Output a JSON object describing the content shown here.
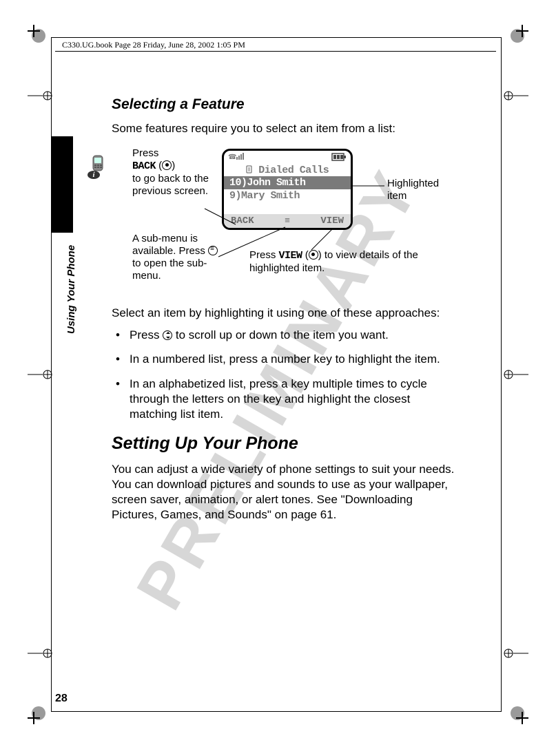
{
  "running_header": "C330.UG.book  Page 28  Friday, June 28, 2002  1:05 PM",
  "side_label": "Using Your Phone",
  "page_number": "28",
  "watermark": "PRELIMINARY",
  "subhead": "Selecting a Feature",
  "intro": "Some features require you to select an item from a list:",
  "figure": {
    "callout_back_1": "Press",
    "callout_back_key": "BACK",
    "callout_back_2": "to go back to the previous screen.",
    "callout_submenu_1": "A sub-menu is available. Press",
    "callout_submenu_2": "to open the sub-menu.",
    "callout_highlight": "Highlighted item",
    "callout_view_1": "Press",
    "callout_view_key": "VIEW",
    "callout_view_2": "to view details of the highlighted item.",
    "screen": {
      "title": "Dialed Calls",
      "row_highlight": "10)John Smith",
      "row_second": "9)Mary Smith",
      "soft_left": "BACK",
      "soft_mid": "≡",
      "soft_right": "VIEW"
    }
  },
  "after_figure": "Select an item by highlighting it using one of these approaches:",
  "bullets": {
    "b1a": "Press ",
    "b1b": " to scroll up or down to the item you want.",
    "b2": "In a numbered list, press a number key to highlight the item.",
    "b3": "In an alphabetized list, press a key multiple times to cycle through the letters on the key and highlight the closest matching list item."
  },
  "section2": "Setting Up Your Phone",
  "para2": "You can adjust a wide variety of phone settings to suit your needs. You can download pictures and sounds to use as your wallpaper, screen saver, animation, or alert tones. See \"Downloading Pictures, Games, and Sounds\" on page 61."
}
